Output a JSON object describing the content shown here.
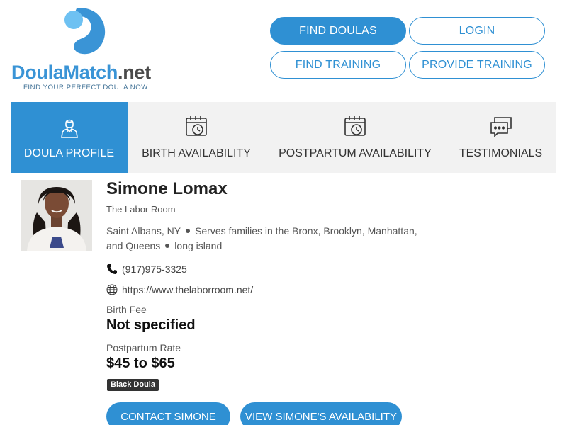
{
  "brand": {
    "name_main": "DoulaMatch",
    "name_suffix": ".net",
    "tagline": "FIND YOUR PERFECT DOULA NOW",
    "color": "#3a94d6"
  },
  "nav": {
    "find_doulas": "FIND DOULAS",
    "login": "LOGIN",
    "find_training": "FIND TRAINING",
    "provide_training": "PROVIDE TRAINING"
  },
  "tabs": [
    {
      "label": "DOULA PROFILE",
      "icon": "person-icon",
      "active": true
    },
    {
      "label": "BIRTH AVAILABILITY",
      "icon": "calendar-clock-icon",
      "active": false
    },
    {
      "label": "POSTPARTUM AVAILABILITY",
      "icon": "calendar-clock-icon",
      "active": false
    },
    {
      "label": "TESTIMONIALS",
      "icon": "chat-bubbles-icon",
      "active": false
    }
  ],
  "profile": {
    "name": "Simone Lomax",
    "business": "The Labor Room",
    "city": "Saint Albans, NY",
    "service_line1": "Serves families in the Bronx, Brooklyn, Manhattan,",
    "service_line2": "and Queens",
    "extra_area": "long island",
    "phone": "(917)975-3325",
    "website": "https://www.thelaborroom.net/",
    "birth_fee_label": "Birth Fee",
    "birth_fee_value": "Not specified",
    "postpartum_rate_label": "Postpartum Rate",
    "postpartum_rate_value": "$45 to $65",
    "badge": "Black Doula"
  },
  "actions": {
    "contact": "CONTACT SIMONE",
    "availability": "VIEW SIMONE'S AVAILABILITY"
  },
  "colors": {
    "accent": "#2f90d3",
    "tab_bg": "#f2f2f2",
    "badge_bg": "#333333"
  }
}
